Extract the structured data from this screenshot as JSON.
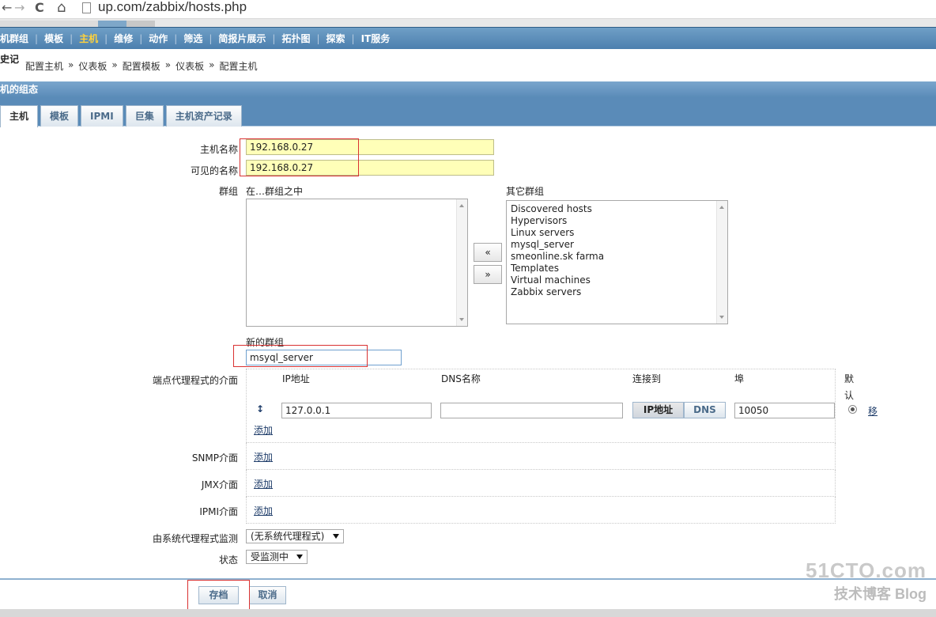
{
  "browser": {
    "url": "up.com/zabbix/hosts.php",
    "back_glyph": "←",
    "forward_glyph": "→",
    "reload_glyph": "C",
    "home_glyph": "⌂"
  },
  "main_menu": {
    "items": [
      {
        "label": "机群组",
        "active": false
      },
      {
        "label": "模板",
        "active": false
      },
      {
        "label": "主机",
        "active": true
      },
      {
        "label": "维修",
        "active": false
      },
      {
        "label": "动作",
        "active": false
      },
      {
        "label": "筛选",
        "active": false
      },
      {
        "label": "简报片展示",
        "active": false
      },
      {
        "label": "拓扑图",
        "active": false
      },
      {
        "label": "探索",
        "active": false
      },
      {
        "label": "IT服务",
        "active": false
      }
    ]
  },
  "history": {
    "label": "史记",
    "breadcrumbs": [
      "配置主机",
      "仪表板",
      "配置模板",
      "仪表板",
      "配置主机"
    ],
    "separator": "»"
  },
  "section": {
    "title": "机的组态"
  },
  "form_tabs": [
    {
      "label": "主机",
      "active": true
    },
    {
      "label": "模板",
      "active": false
    },
    {
      "label": "IPMI",
      "active": false
    },
    {
      "label": "巨集",
      "active": false
    },
    {
      "label": "主机资产记录",
      "active": false
    }
  ],
  "form": {
    "host_name_label": "主机名称",
    "host_name_value": "192.168.0.27",
    "visible_name_label": "可见的名称",
    "visible_name_value": "192.168.0.27",
    "groups_label": "群组",
    "in_groups_label": "在…群组之中",
    "other_groups_label": "其它群组",
    "other_groups": [
      "Discovered hosts",
      "Hypervisors",
      "Linux servers",
      "mysql_server",
      "smeonline.sk farma",
      "Templates",
      "Virtual machines",
      "Zabbix servers"
    ],
    "move_left": "«",
    "move_right": "»",
    "new_group_label": "新的群组",
    "new_group_value": "msyql_server",
    "agent_interfaces_label": "端点代理程式的介面",
    "col_ip": "IP地址",
    "col_dns": "DNS名称",
    "col_connect": "连接到",
    "col_port": "埠",
    "col_default_1": "默",
    "col_default_2": "认",
    "ip_value": "127.0.0.1",
    "dns_value": "",
    "connect_ip": "IP地址",
    "connect_dns": "DNS",
    "port_value": "10050",
    "remove_link": "移",
    "add_link": "添加",
    "snmp_label": "SNMP介面",
    "jmx_label": "JMX介面",
    "ipmi_label": "IPMI介面",
    "proxy_label": "由系统代理程式监测",
    "proxy_value": "(无系统代理程式)",
    "status_label": "状态",
    "status_value": "受监测中",
    "drag_glyph": "↕"
  },
  "buttons": {
    "save": "存档",
    "cancel": "取消"
  },
  "watermark": {
    "line1": "51CTO.com",
    "line2": "技术博客 Blog"
  }
}
